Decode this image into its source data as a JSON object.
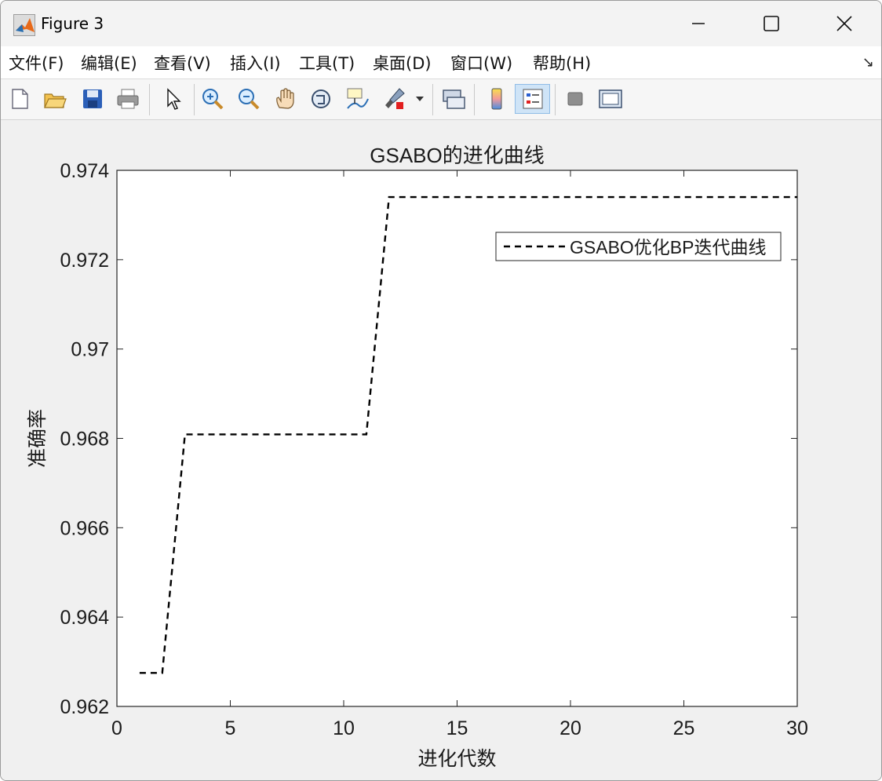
{
  "window": {
    "title": "Figure 3"
  },
  "menubar": {
    "items": [
      "文件(F)",
      "编辑(E)",
      "查看(V)",
      "插入(I)",
      "工具(T)",
      "桌面(D)",
      "窗口(W)",
      "帮助(H)"
    ],
    "corner_glyph": "↘"
  },
  "toolbar": {
    "buttons": [
      "new-figure-icon",
      "open-file-icon",
      "save-icon",
      "print-icon",
      "pointer-icon",
      "zoom-in-icon",
      "zoom-out-icon",
      "pan-hand-icon",
      "rotate-3d-icon",
      "data-cursor-icon",
      "brush-icon",
      "link-plot-icon",
      "colorbar-icon",
      "legend-icon",
      "hide-plot-tools-icon",
      "show-plot-tools-icon"
    ],
    "active": "legend-icon"
  },
  "chart_data": {
    "type": "line",
    "title": "GSABO的进化曲线",
    "xlabel": "进化代数",
    "ylabel": "准确率",
    "xlim": [
      0,
      30
    ],
    "ylim": [
      0.962,
      0.974
    ],
    "xticks": [
      "0",
      "5",
      "10",
      "15",
      "20",
      "25",
      "30"
    ],
    "yticks": [
      "0.962",
      "0.964",
      "0.966",
      "0.968",
      "0.97",
      "0.972",
      "0.974"
    ],
    "line_style": "dashed",
    "line_color": "#000000",
    "legend_position": "top-right",
    "series": [
      {
        "name": "GSABO优化BP迭代曲线",
        "x": [
          1,
          2,
          3,
          4,
          5,
          6,
          7,
          8,
          9,
          10,
          11,
          12,
          13,
          14,
          15,
          16,
          17,
          18,
          19,
          20,
          21,
          22,
          23,
          24,
          25,
          26,
          27,
          28,
          29,
          30
        ],
        "y": [
          0.96275,
          0.96275,
          0.96809,
          0.96809,
          0.96809,
          0.96809,
          0.96809,
          0.96809,
          0.96809,
          0.96809,
          0.96809,
          0.9734,
          0.9734,
          0.9734,
          0.9734,
          0.9734,
          0.9734,
          0.9734,
          0.9734,
          0.9734,
          0.9734,
          0.9734,
          0.9734,
          0.9734,
          0.9734,
          0.9734,
          0.9734,
          0.9734,
          0.9734,
          0.9734
        ]
      }
    ]
  }
}
